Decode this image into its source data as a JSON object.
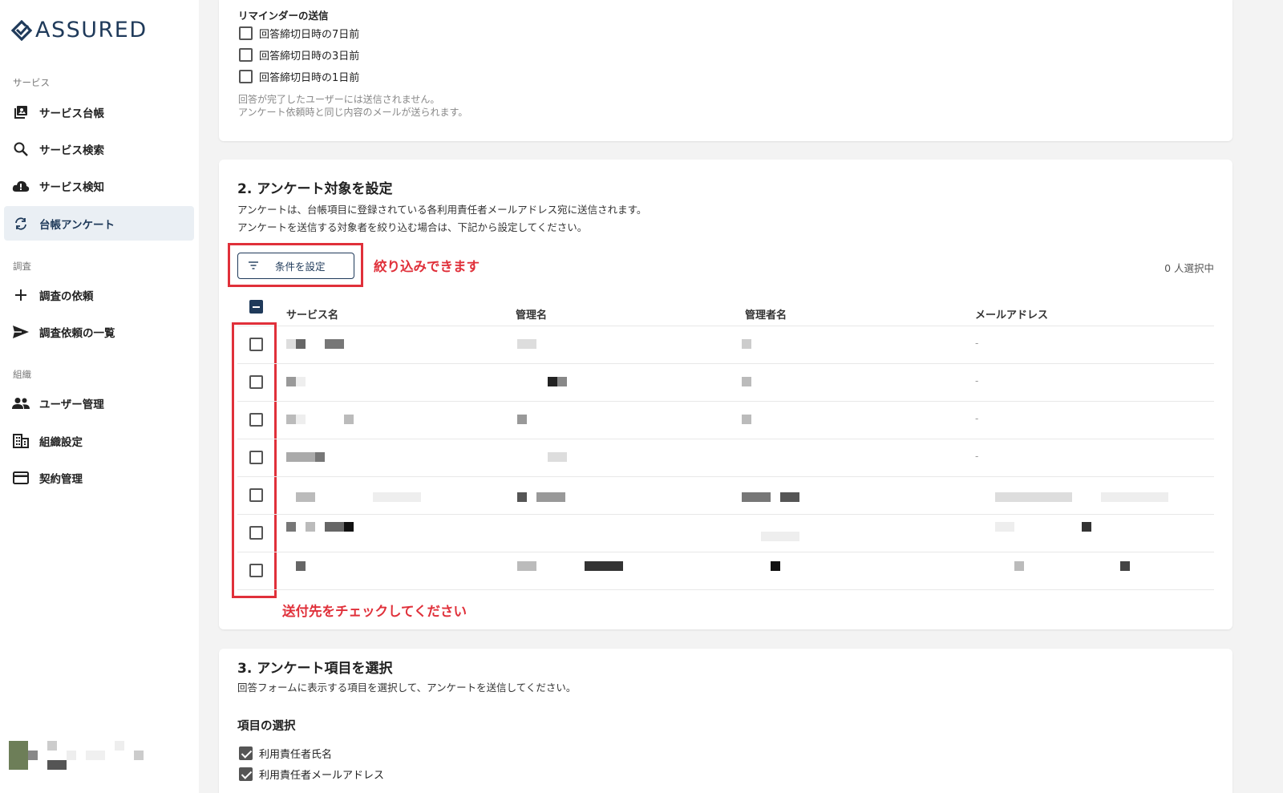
{
  "sidebar": {
    "logo_text": "ASSURED",
    "sections": [
      {
        "label": "サービス"
      },
      {
        "label": "調査"
      },
      {
        "label": "組織"
      }
    ],
    "items": [
      {
        "label": "サービス台帳",
        "icon": "library-icon"
      },
      {
        "label": "サービス検索",
        "icon": "search-icon"
      },
      {
        "label": "サービス検知",
        "icon": "cloud-alert-icon"
      },
      {
        "label": "台帳アンケート",
        "icon": "sync-icon"
      },
      {
        "label": "調査の依頼",
        "icon": "plus-icon"
      },
      {
        "label": "調査依頼の一覧",
        "icon": "send-icon"
      },
      {
        "label": "ユーザー管理",
        "icon": "people-icon"
      },
      {
        "label": "組織設定",
        "icon": "building-icon"
      },
      {
        "label": "契約管理",
        "icon": "card-icon"
      }
    ],
    "active_item": "台帳アンケート"
  },
  "reminder": {
    "title": "リマインダーの送信",
    "options": [
      {
        "label": "回答締切日時の7日前",
        "checked": false
      },
      {
        "label": "回答締切日時の3日前",
        "checked": false
      },
      {
        "label": "回答締切日時の1日前",
        "checked": false
      }
    ],
    "note_line1": "回答が完了したユーザーには送信されません。",
    "note_line2": "アンケート依頼時と同じ内容のメールが送られます。"
  },
  "target": {
    "title": "2. アンケート対象を設定",
    "desc_line1": "アンケートは、台帳項目に登録されている各利用責任者メールアドレス宛に送信されます。",
    "desc_line2": "アンケートを送信する対象者を絞り込む場合は、下記から設定してください。",
    "filter_button": "条件を設定",
    "annotation_filter": "絞り込みできます",
    "selected_count": "0 人選択中",
    "columns": [
      "サービス名",
      "管理名",
      "管理者名",
      "メールアドレス"
    ],
    "rows_email": [
      "-",
      "-",
      "-",
      "-",
      "",
      "",
      ""
    ],
    "annotation_check": "送付先をチェックしてください"
  },
  "items": {
    "title": "3. アンケート項目を選択",
    "desc": "回答フォームに表示する項目を選択して、アンケートを送信してください。",
    "subtitle": "項目の選択",
    "options": [
      {
        "label": "利用責任者氏名",
        "checked": true
      },
      {
        "label": "利用責任者メールアドレス",
        "checked": true
      }
    ]
  },
  "colors": {
    "brand": "#1f3a5a",
    "annotation": "#e0303a"
  }
}
